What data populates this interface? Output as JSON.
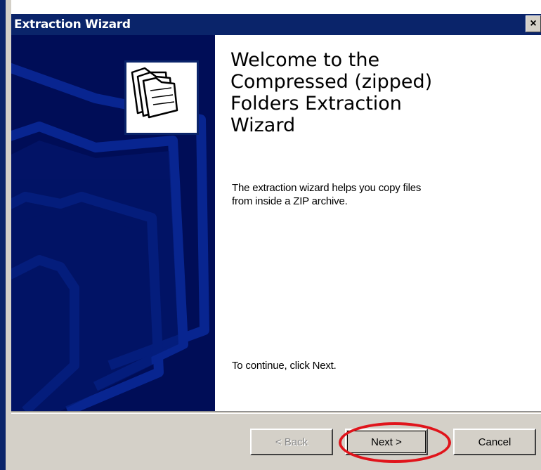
{
  "window": {
    "title": "Extraction Wizard",
    "close_glyph": "×"
  },
  "welcome": {
    "heading": "Welcome to the\nCompressed (zipped)\nFolders Extraction\nWizard",
    "description": "The extraction wizard helps you copy files\nfrom inside a ZIP archive.",
    "continue_text": "To continue, click Next."
  },
  "buttons": {
    "back": "< Back",
    "next": "Next >",
    "cancel": "Cancel"
  },
  "icons": {
    "banner_icon": "folders-icon"
  },
  "colors": {
    "titlebar": "#0a246a",
    "banner": "#000d57",
    "highlight": "#e0141b"
  }
}
